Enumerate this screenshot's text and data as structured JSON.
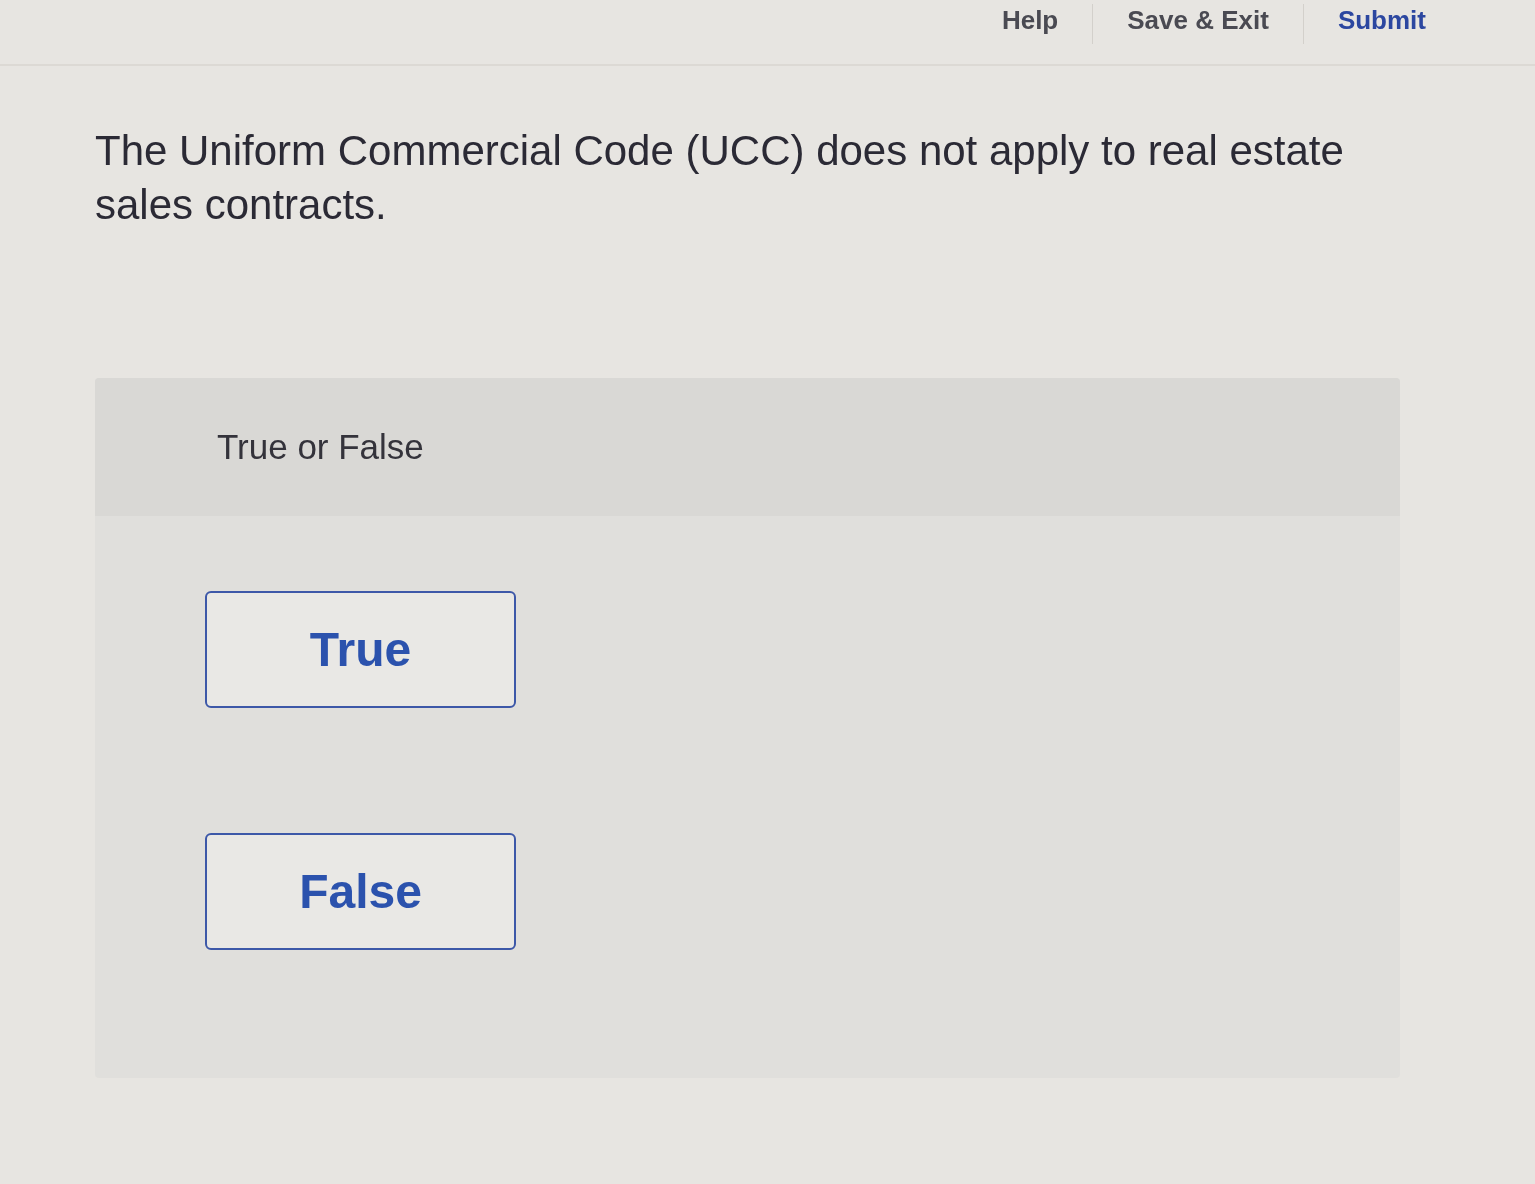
{
  "header": {
    "links": [
      {
        "label": "Help"
      },
      {
        "label": "Save & Exit"
      }
    ],
    "submit": "Submit"
  },
  "question": {
    "text": "The Uniform Commercial Code (UCC) does not apply to real estate sales contracts."
  },
  "answer_panel": {
    "title": "True or False",
    "options": [
      {
        "label": "True",
        "selected": false
      },
      {
        "label": "False",
        "selected": false
      }
    ]
  }
}
